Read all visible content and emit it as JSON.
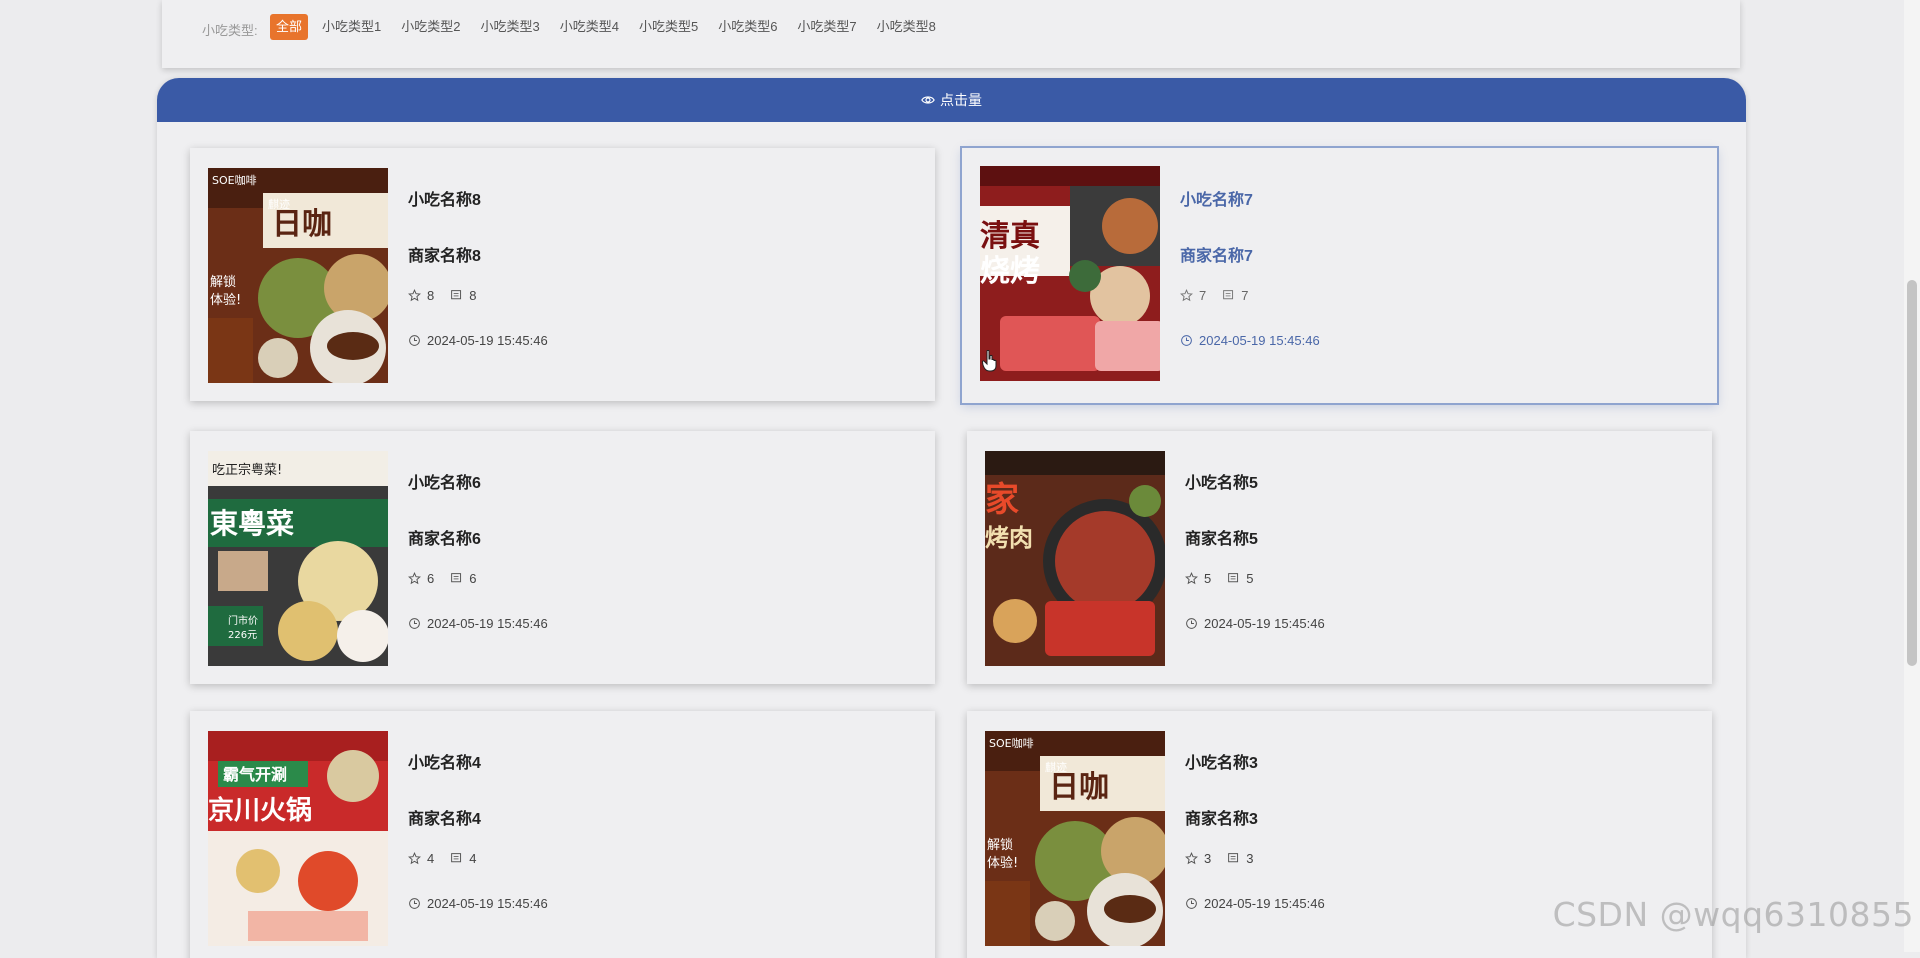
{
  "filter": {
    "label": "小吃类型:",
    "options": [
      "全部",
      "小吃类型1",
      "小吃类型2",
      "小吃类型3",
      "小吃类型4",
      "小吃类型5",
      "小吃类型6",
      "小吃类型7",
      "小吃类型8"
    ],
    "selected": "全部"
  },
  "sort": {
    "label": "点击量",
    "icon": "eye-icon"
  },
  "cards": [
    {
      "name": "小吃名称8",
      "merchant": "商家名称8",
      "favorites": "8",
      "comments": "8",
      "time": "2024-05-19 15:45:46",
      "image_text": [
        "SOE咖啡",
        "麒迹",
        "日咖",
        "解锁",
        "体验!"
      ],
      "highlighted": false
    },
    {
      "name": "小吃名称7",
      "merchant": "商家名称7",
      "favorites": "7",
      "comments": "7",
      "time": "2024-05-19 15:45:46",
      "image_text": [
        "清真",
        "烧烤"
      ],
      "highlighted": true
    },
    {
      "name": "小吃名称6",
      "merchant": "商家名称6",
      "favorites": "6",
      "comments": "6",
      "time": "2024-05-19 15:45:46",
      "image_text": [
        "吃正宗粤菜!",
        "東粵菜",
        "门市价",
        "226元"
      ],
      "highlighted": false
    },
    {
      "name": "小吃名称5",
      "merchant": "商家名称5",
      "favorites": "5",
      "comments": "5",
      "time": "2024-05-19 15:45:46",
      "image_text": [
        "家",
        "烤肉"
      ],
      "highlighted": false
    },
    {
      "name": "小吃名称4",
      "merchant": "商家名称4",
      "favorites": "4",
      "comments": "4",
      "time": "2024-05-19 15:45:46",
      "image_text": [
        "霸气开涮",
        "京川火锅"
      ],
      "highlighted": false
    },
    {
      "name": "小吃名称3",
      "merchant": "商家名称3",
      "favorites": "3",
      "comments": "3",
      "time": "2024-05-19 15:45:46",
      "image_text": [
        "SOE咖啡",
        "麒迹",
        "日咖",
        "解锁",
        "体验!"
      ],
      "highlighted": false
    }
  ],
  "watermark": "CSDN @wqq6310855",
  "colors": {
    "accent": "#3a5aa6",
    "active_chip": "#e8742c",
    "highlight_text": "#4a67a8"
  }
}
